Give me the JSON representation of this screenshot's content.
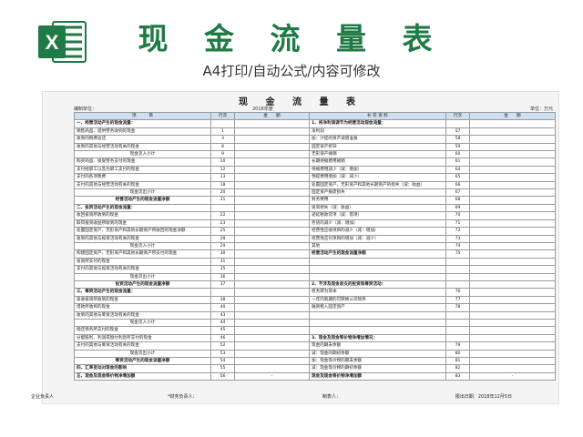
{
  "banner": {
    "title": "现 金 流 量 表",
    "subtitle": "A4打印/自动公式/内容可修改",
    "logo_letter": "X"
  },
  "sheet": {
    "heading": "现 金 流 量 表",
    "unit_left": "编制单位：",
    "year": "2018年度",
    "unit_right": "单位：万元",
    "headers": [
      "项　　　目",
      "行次",
      "金　　额",
      "1、将净利润调节为经营活动现金流量：",
      "补 充 资 料",
      "行次",
      "金　　额"
    ],
    "rows": [
      {
        "l": "一、经营活动产生的现金流量：",
        "lb": true,
        "ln": "",
        "r": "1、将净利润调节为经营活动现金流量：",
        "rb": true,
        "rn": ""
      },
      {
        "l": "销售商品、提供劳务收到的现金",
        "ln": "1",
        "r": "净利润",
        "rn": "57"
      },
      {
        "l": "收到的税费返还",
        "ln": "3",
        "r": "加：计提的资产减值准备",
        "rn": "58"
      },
      {
        "l": "收到的其他与经营活动有关的现金",
        "ln": "8",
        "r": "固定资产折旧",
        "rn": "59"
      },
      {
        "l": "现金流入小计",
        "lc": true,
        "ln": "9",
        "r": "无形资产摊销",
        "rn": "60"
      },
      {
        "l": "购买商品、接受劳务支付的现金",
        "ln": "10",
        "r": "长期待摊费用摊销",
        "rn": "61"
      },
      {
        "l": "支付给职工以及为职工支付的现金",
        "ln": "12",
        "r": "待摊费用减少（减：增加）",
        "rn": "64"
      },
      {
        "l": "支付的各项税费",
        "ln": "13",
        "r": "预提费用增加（减：减少）",
        "rn": "65"
      },
      {
        "l": "支付的其他与经营活动有关的现金",
        "ln": "18",
        "r": "处置固定资产、无形资产和其他长期资产的损失（减：收益）",
        "rn": "66"
      },
      {
        "l": "现金流出小计",
        "lc": true,
        "ln": "20",
        "r": "固定资产报废损失",
        "rn": "67"
      },
      {
        "l": "经营活动产生的现金流量净额",
        "lb": true,
        "lc": true,
        "ln": "21",
        "r": "财务费用",
        "rn": "68"
      },
      {
        "l": "二、投资活动产生的现金流量：",
        "lb": true,
        "ln": "",
        "r": "投资损失（减：收益）",
        "rn": "69"
      },
      {
        "l": "收回投资所收到的现金",
        "ln": "22",
        "r": "递延税款贷项（减：借项）",
        "rn": "70"
      },
      {
        "l": "取得投资收益所收到的现金",
        "ln": "23",
        "r": "存货的减少（减：增加）",
        "rn": "71"
      },
      {
        "l": "处置固定资产、无形资产和其他长期资产所收回的现金净额",
        "ln": "25",
        "r": "经营性应收项目的减少（减：增加）",
        "rn": "72"
      },
      {
        "l": "收到的其他与投资活动有关的现金",
        "ln": "28",
        "r": "经营性应付项目的增加（减：减少）",
        "rn": "73"
      },
      {
        "l": "现金流入小计",
        "lc": true,
        "ln": "29",
        "r": "其他",
        "rn": "74"
      },
      {
        "l": "购建固定资产、无形资产和其他长期资产所支付的现金",
        "ln": "30",
        "r": "经营活动产生的现金流量净额",
        "rb": true,
        "rn": "75"
      },
      {
        "l": "投资所支付的现金",
        "ln": "31",
        "r": "",
        "rn": ""
      },
      {
        "l": "支付的其他与投资活动有关的现金",
        "ln": "35",
        "r": "",
        "rn": ""
      },
      {
        "l": "现金流出小计",
        "lc": true,
        "ln": "36",
        "r": "",
        "rn": ""
      },
      {
        "l": "投资活动产生的现金流量净额",
        "lb": true,
        "lc": true,
        "ln": "37",
        "r": "2、不涉及现金收支的投资和筹资活动：",
        "rb": true,
        "rn": ""
      },
      {
        "l": "三、筹资活动产生的现金流量：",
        "lb": true,
        "ln": "",
        "r": "债务转为资本",
        "rn": "76"
      },
      {
        "l": "吸收投资所收到的现金",
        "ln": "38",
        "r": "一年内到期的可转换公司债券",
        "rn": "77"
      },
      {
        "l": "借款所收到的现金",
        "ln": "40",
        "r": "融资租入固定资产",
        "rn": "78"
      },
      {
        "l": "收到的其他与筹资活动有关的现金",
        "ln": "43",
        "r": "",
        "rn": ""
      },
      {
        "l": "现金流入小计",
        "lc": true,
        "ln": "44",
        "r": "",
        "rn": ""
      },
      {
        "l": "偿还债务所支付的现金",
        "ln": "45",
        "r": "",
        "rn": ""
      },
      {
        "l": "分配股利、利润或偿付利息所支付的现金",
        "ln": "46",
        "r": "3、现金及现金等价物净增加情况：",
        "rb": true,
        "rn": ""
      },
      {
        "l": "支付的其他与筹资活动有关的现金",
        "ln": "52",
        "r": "现金的期末余额",
        "rn": "79"
      },
      {
        "l": "现金流出小计",
        "lc": true,
        "ln": "53",
        "r": "减：现金的期初余额",
        "rn": "80"
      },
      {
        "l": "筹资活动产生的现金流量净额",
        "lb": true,
        "lc": true,
        "ln": "54",
        "r": "加：现金等价物的期末余额",
        "rn": "81"
      },
      {
        "l": "四、汇率变动对现金的影响",
        "lb": true,
        "ln": "55",
        "r": "减：现金等价物的期初余额",
        "rn": "82"
      },
      {
        "l": "五、现金及现金等价物净增加额",
        "lb": true,
        "ln": "56",
        "lv": "-",
        "r": "现金及现金等价物净增加额",
        "rb": true,
        "rn": "83",
        "rv": "-"
      }
    ]
  },
  "footer": {
    "a": "企业负责人",
    "b": "*财务负责人：",
    "c": "制表人：",
    "d": "报出日期：2018年12月5日"
  }
}
